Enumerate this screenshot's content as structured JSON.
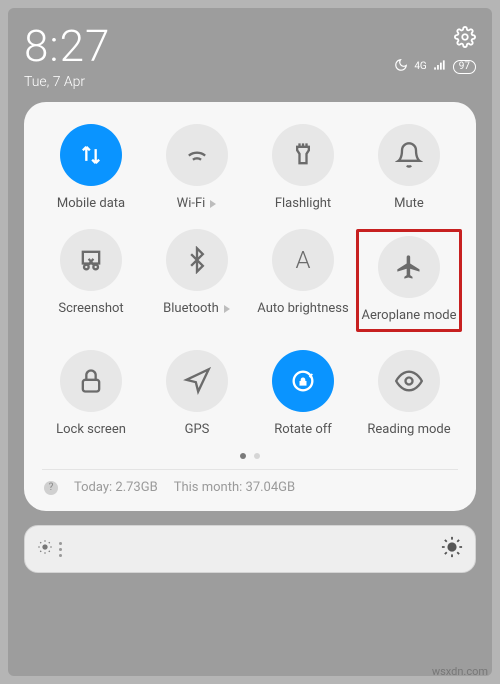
{
  "status": {
    "time": "8:27",
    "date": "Tue, 7 Apr",
    "network": "4G",
    "battery": "97"
  },
  "tiles": [
    {
      "label": "Mobile data",
      "active": true,
      "expandable": false
    },
    {
      "label": "Wi-Fi",
      "active": false,
      "expandable": true
    },
    {
      "label": "Flashlight",
      "active": false,
      "expandable": false
    },
    {
      "label": "Mute",
      "active": false,
      "expandable": false
    },
    {
      "label": "Screenshot",
      "active": false,
      "expandable": false
    },
    {
      "label": "Bluetooth",
      "active": false,
      "expandable": true
    },
    {
      "label": "Auto brightness",
      "active": false,
      "expandable": false
    },
    {
      "label": "Aeroplane mode",
      "active": false,
      "expandable": false
    },
    {
      "label": "Lock screen",
      "active": false,
      "expandable": false
    },
    {
      "label": "GPS",
      "active": false,
      "expandable": false
    },
    {
      "label": "Rotate off",
      "active": true,
      "expandable": false
    },
    {
      "label": "Reading mode",
      "active": false,
      "expandable": false
    }
  ],
  "usage": {
    "today_label": "Today:",
    "today_value": "2.73GB",
    "month_label": "This month:",
    "month_value": "37.04GB"
  },
  "highlighted_tile_index": 7,
  "watermark": "wsxdn.com"
}
